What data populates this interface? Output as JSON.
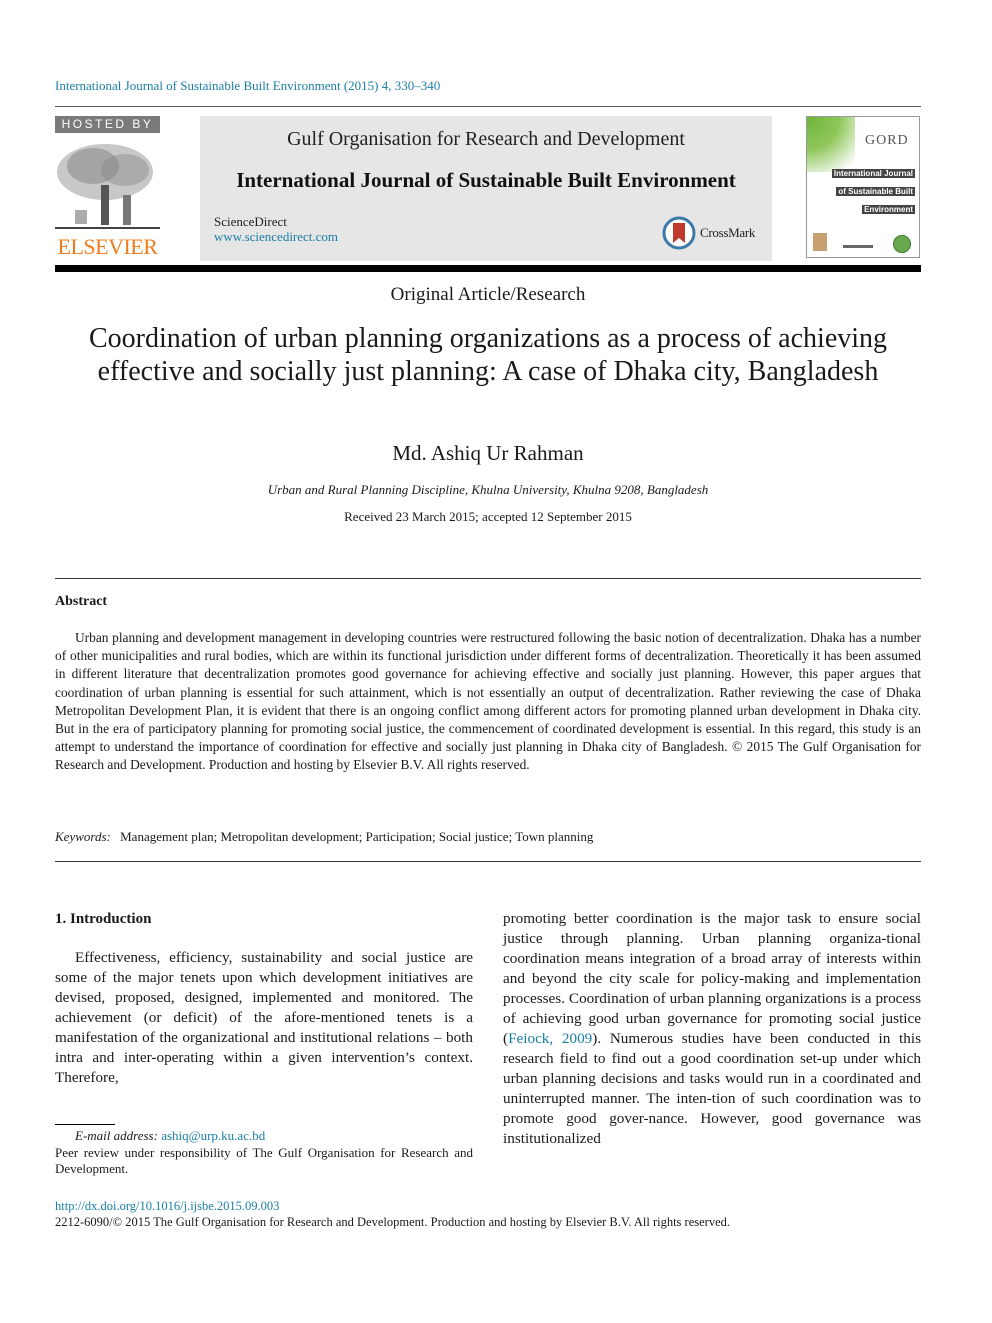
{
  "header": {
    "journal_reference": "International Journal of Sustainable Built Environment (2015) 4, 330–340",
    "hosted_by": "HOSTED BY",
    "publisher_logo": "ELSEVIER",
    "organisation": "Gulf Organisation for Research and Development",
    "journal_title": "International Journal of Sustainable Built Environment",
    "sciencedirect_label": "ScienceDirect",
    "sciencedirect_url": "www.sciencedirect.com",
    "crossmark_label": "CrossMark",
    "cover": {
      "brand": "GORD",
      "title_lines": [
        "International Journal",
        "of Sustainable Built",
        "Environment"
      ]
    }
  },
  "article": {
    "type": "Original Article/Research",
    "title": "Coordination of urban planning organizations as a process of achieving effective and socially just planning: A case of Dhaka city, Bangladesh",
    "author": "Md. Ashiq Ur Rahman",
    "affiliation": "Urban and Rural Planning Discipline, Khulna University, Khulna 9208, Bangladesh",
    "received": "Received 23 March 2015; accepted 12 September 2015"
  },
  "abstract": {
    "heading": "Abstract",
    "text": "Urban planning and development management in developing countries were restructured following the basic notion of decentralization. Dhaka has a number of other municipalities and rural bodies, which are within its functional jurisdiction under different forms of decentralization. Theoretically it has been assumed in different literature that decentralization promotes good governance for achieving effective and socially just planning. However, this paper argues that coordination of urban planning is essential for such attainment, which is not essentially an output of decentralization. Rather reviewing the case of Dhaka Metropolitan Development Plan, it is evident that there is an ongoing conflict among different actors for promoting planned urban development in Dhaka city. But in the era of participatory planning for promoting social justice, the commencement of coordinated development is essential. In this regard, this study is an attempt to understand the importance of coordination for effective and socially just planning in Dhaka city of Bangladesh.",
    "copyright": "© 2015 The Gulf Organisation for Research and Development. Production and hosting by Elsevier B.V. All rights reserved."
  },
  "keywords": {
    "label": "Keywords:",
    "text": "Management plan; Metropolitan development; Participation; Social justice; Town planning"
  },
  "introduction": {
    "heading": "1. Introduction",
    "left_column": "Effectiveness, efficiency, sustainability and social justice are some of the major tenets upon which development initiatives are devised, proposed, designed, implemented and monitored. The achievement (or deficit) of the afore-mentioned tenets is a manifestation of the organizational and institutional relations – both intra and inter-operating within a given intervention’s context. Therefore,",
    "right_column_before_cite": "promoting better coordination is the major task to ensure social justice through planning. Urban planning organiza-tional coordination means integration of a broad array of interests within and beyond the city scale for policy-making and implementation processes. Coordination of urban planning organizations is a process of achieving good urban governance for promoting social justice (",
    "citation": "Feiock, 2009",
    "right_column_after_cite": "). Numerous studies have been conducted in this research field to find out a good coordination set-up under which urban planning decisions and tasks would run in a coordinated and uninterrupted manner. The inten-tion of such coordination was to promote good gover-nance. However, good governance was institutionalized"
  },
  "footnote": {
    "email_label": "E-mail address:",
    "email": "ashiq@urp.ku.ac.bd",
    "peer_review": "Peer review under responsibility of The Gulf Organisation for Research and Development."
  },
  "footer": {
    "doi": "http://dx.doi.org/10.1016/j.ijsbe.2015.09.003",
    "copyright": "2212-6090/© 2015 The Gulf Organisation for Research and Development. Production and hosting by Elsevier B.V. All rights reserved."
  },
  "colors": {
    "link": "#1a7ea6",
    "elsevier_orange": "#f07c1e",
    "header_box": "#e6e6e6"
  }
}
